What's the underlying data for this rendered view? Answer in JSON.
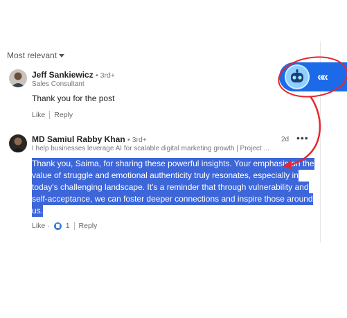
{
  "sort": {
    "label": "Most relevant"
  },
  "comments": [
    {
      "name": "Jeff Sankiewicz",
      "degree": "• 3rd+",
      "headline": "Sales Consultant",
      "text": "Thank you for the post",
      "like_label": "Like",
      "reply_label": "Reply"
    },
    {
      "name": "MD Samiul Rabby Khan",
      "degree": "• 3rd+",
      "headline": "I help businesses leverage AI for scalable digital marketing growth | Project ...",
      "time": "2d",
      "more": "•••",
      "text_lines": [
        "Thank you, Saima, for sharing these powerful insights. Your emphasis on the",
        "value of struggle and emotional authenticity truly resonates, especially in",
        "today's challenging landscape. It's a reminder that through vulnerability and",
        "self-acceptance, we can foster deeper connections and inspire those around",
        "us."
      ],
      "like_label": "Like ·",
      "reaction_count": "1",
      "reply_label": "Reply"
    }
  ],
  "widget": {
    "icon": "robot-icon",
    "chevron": "«"
  },
  "colors": {
    "highlight": "#3d66d8",
    "widget": "#1c6ae8",
    "annotation": "#e8262b"
  }
}
